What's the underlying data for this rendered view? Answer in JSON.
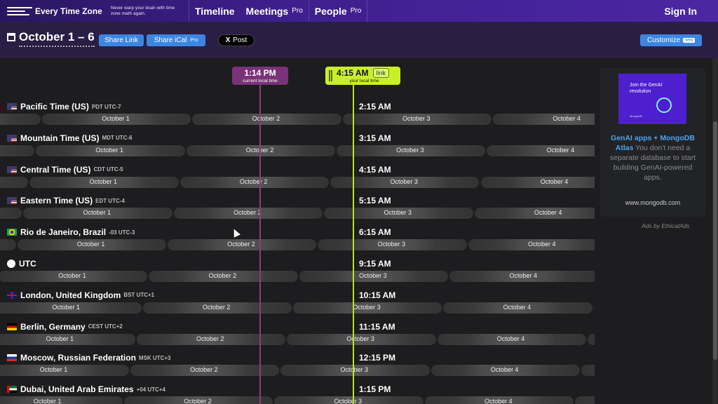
{
  "nav": {
    "logo_name": "Every Time Zone",
    "tagline": "Never warp your brain with time zone math again.",
    "links": [
      {
        "label": "Timeline",
        "pro": ""
      },
      {
        "label": "Meetings",
        "pro": "Pro"
      },
      {
        "label": "People",
        "pro": "Pro"
      }
    ],
    "signin": "Sign In"
  },
  "toolbar": {
    "title": "October 1 – 6",
    "share_link": "Share Link",
    "share_ical": "Share iCal",
    "share_ical_pro": "Pro",
    "xpost": "Post",
    "x_icon": "x-logo-icon",
    "customize": "Customize",
    "customize_badge": "new"
  },
  "markers": {
    "current_time": "1:14 PM",
    "current_sub": "current local time",
    "local_time": "4:15 AM",
    "local_sub": "your local time",
    "local_link": "link"
  },
  "zones": [
    {
      "name": "Pacific Time (US)",
      "abbr": "PDT UTC-7",
      "time": "2:15 AM",
      "flag": "us",
      "offset": 0
    },
    {
      "name": "Mountain Time (US)",
      "abbr": "MDT UTC-6",
      "time": "3:15 AM",
      "flag": "us",
      "offset": -1
    },
    {
      "name": "Central Time (US)",
      "abbr": "CDT UTC-5",
      "time": "4:15 AM",
      "flag": "us",
      "offset": -2
    },
    {
      "name": "Eastern Time (US)",
      "abbr": "EDT UTC-4",
      "time": "5:15 AM",
      "flag": "us",
      "offset": -3
    },
    {
      "name": "Rio de Janeiro, Brazil",
      "abbr": "-03 UTC-3",
      "time": "6:15 AM",
      "flag": "br",
      "offset": -4
    },
    {
      "name": "UTC",
      "abbr": "",
      "time": "9:15 AM",
      "flag": "utc",
      "offset": -7
    },
    {
      "name": "London, United Kingdom",
      "abbr": "BST UTC+1",
      "time": "10:15 AM",
      "flag": "gb",
      "offset": -8
    },
    {
      "name": "Berlin, Germany",
      "abbr": "CEST UTC+2",
      "time": "11:15 AM",
      "flag": "de",
      "offset": -9
    },
    {
      "name": "Moscow, Russian Federation",
      "abbr": "MSK UTC+3",
      "time": "12:15 PM",
      "flag": "ru",
      "offset": -10
    },
    {
      "name": "Dubai, United Arab Emirates",
      "abbr": "+04 UTC+4",
      "time": "1:15 PM",
      "flag": "ae",
      "offset": -11
    }
  ],
  "days": [
    "October 1",
    "October 2",
    "October 3",
    "October 4"
  ],
  "ad": {
    "image_text": "Join the GenAI revolution",
    "image_small": "MongoDB",
    "headline": "GenAI apps + MongoDB Atlas",
    "body": "You don't need a separate database to start building GenAI-powered apps.",
    "url": "www.mongodb.com",
    "by": "Ads by EthicalAds"
  },
  "colors": {
    "nav_bg": "#3e1f8d",
    "toolbar_bg": "#2b1e45",
    "button": "#3d86e0",
    "current_marker": "#7a3278",
    "local_marker": "#c9ef2b"
  }
}
